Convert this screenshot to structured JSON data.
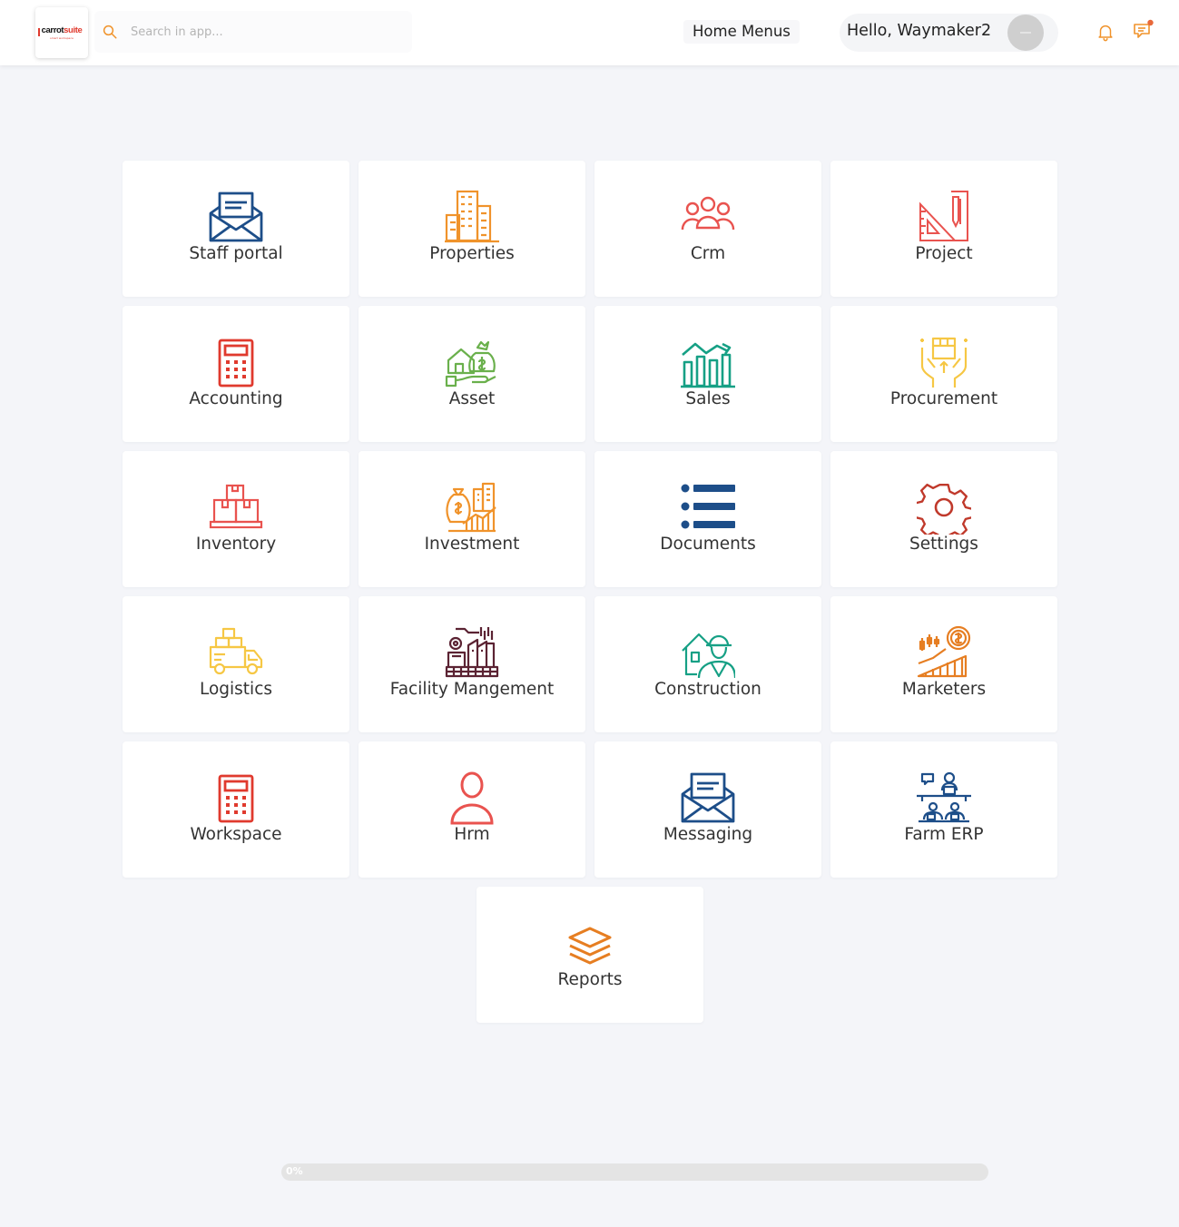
{
  "header": {
    "logo": {
      "brand_dark": "carrot",
      "brand_accent": "suite",
      "tagline": "smart workspace"
    },
    "search": {
      "placeholder": "Search in app...",
      "value": ""
    },
    "home_menus": "Home Menus",
    "greeting": "Hello, Waymaker2",
    "icons": {
      "search": "search-icon",
      "notifications": "bell-icon",
      "messages": "chat-icon"
    },
    "colors": {
      "accent": "#f0932b",
      "brand_red": "#e03a2e"
    }
  },
  "modules": [
    {
      "label": "Staff portal",
      "icon": "envelope-icon",
      "color": "#1d4e89"
    },
    {
      "label": "Properties",
      "icon": "buildings-icon",
      "color": "#f0932b"
    },
    {
      "label": "Crm",
      "icon": "people-icon",
      "color": "#e9534f"
    },
    {
      "label": "Project",
      "icon": "drafting-tools-icon",
      "color": "#e9534f"
    },
    {
      "label": "Accounting",
      "icon": "calculator-icon",
      "color": "#e03a2e"
    },
    {
      "label": "Asset",
      "icon": "money-house-icon",
      "color": "#6ab04c"
    },
    {
      "label": "Sales",
      "icon": "sales-chart-icon",
      "color": "#16a085"
    },
    {
      "label": "Procurement",
      "icon": "hands-box-icon",
      "color": "#f6c744"
    },
    {
      "label": "Inventory",
      "icon": "boxes-icon",
      "color": "#e9534f"
    },
    {
      "label": "Investment",
      "icon": "investment-bag-icon",
      "color": "#f0932b"
    },
    {
      "label": "Documents",
      "icon": "list-icon",
      "color": "#1d4e89"
    },
    {
      "label": "Settings",
      "icon": "gear-icon",
      "color": "#c0392b"
    },
    {
      "label": "Logistics",
      "icon": "truck-icon",
      "color": "#f6c744"
    },
    {
      "label": "Facility Mangement",
      "icon": "factory-icon",
      "color": "#5b2333"
    },
    {
      "label": "Construction",
      "icon": "worker-house-icon",
      "color": "#16a085"
    },
    {
      "label": "Marketers",
      "icon": "growth-coin-icon",
      "color": "#e67e22"
    },
    {
      "label": "Workspace",
      "icon": "calculator-icon",
      "color": "#e03a2e"
    },
    {
      "label": "Hrm",
      "icon": "user-icon",
      "color": "#e9534f"
    },
    {
      "label": "Messaging",
      "icon": "envelope-icon",
      "color": "#1d4e89"
    },
    {
      "label": "Farm ERP",
      "icon": "team-desk-icon",
      "color": "#1d4e89"
    },
    {
      "label": "Reports",
      "icon": "layers-icon",
      "color": "#e67e22"
    }
  ],
  "progress": {
    "label": "0%",
    "value": 0
  }
}
